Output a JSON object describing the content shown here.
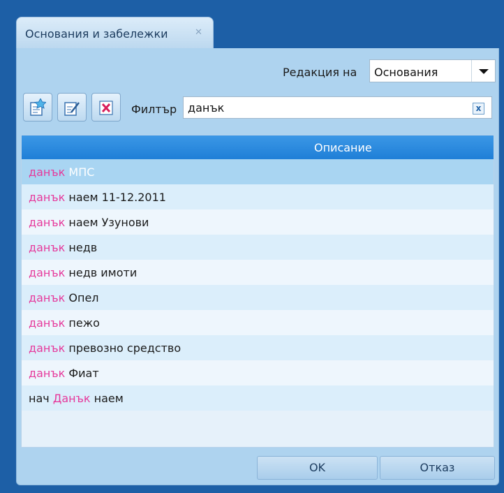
{
  "window": {
    "tab_title": "Основания и забележки",
    "tab_close_glyph": "✕"
  },
  "edition": {
    "label": "Редакция на",
    "selected_value": "Основания"
  },
  "toolbar": {
    "buttons": [
      {
        "name": "add-icon"
      },
      {
        "name": "edit-icon"
      },
      {
        "name": "delete-icon"
      }
    ]
  },
  "filter": {
    "label": "Филтър",
    "value": "данък",
    "clear_glyph": "x"
  },
  "grid": {
    "header": "Описание",
    "rows": [
      {
        "pre": "",
        "hl": "данък",
        "rest": " МПС",
        "state": "selected"
      },
      {
        "pre": "",
        "hl": "данък",
        "rest": " наем 11-12.2011",
        "state": "alt"
      },
      {
        "pre": "",
        "hl": "данък",
        "rest": " наем Узунови",
        "state": "plain"
      },
      {
        "pre": "",
        "hl": "данък",
        "rest": " недв",
        "state": "alt"
      },
      {
        "pre": "",
        "hl": "данък",
        "rest": " недв имоти",
        "state": "plain"
      },
      {
        "pre": "",
        "hl": "данък",
        "rest": " Опел",
        "state": "alt"
      },
      {
        "pre": "",
        "hl": "данък",
        "rest": " пежо",
        "state": "plain"
      },
      {
        "pre": "",
        "hl": "данък",
        "rest": " превозно средство",
        "state": "alt"
      },
      {
        "pre": "",
        "hl": "данък",
        "rest": " Фиат",
        "state": "plain"
      },
      {
        "pre": "нач ",
        "hl": "Данък",
        "rest": " наем",
        "state": "alt"
      }
    ]
  },
  "footer": {
    "ok_label": "OK",
    "cancel_label": "Отказ"
  },
  "colors": {
    "highlight": "#e6399b",
    "header": "#1f7fd7",
    "panel": "#aed3ef",
    "frame": "#1d5fa6"
  }
}
